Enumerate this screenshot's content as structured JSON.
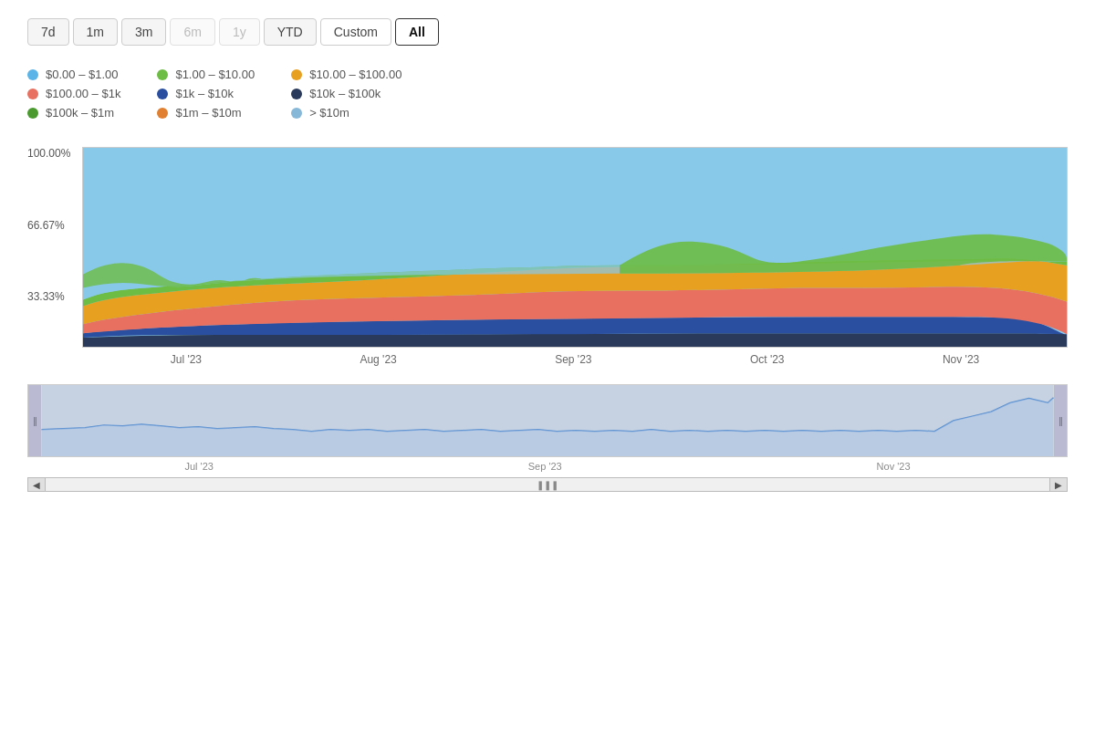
{
  "timeButtons": [
    {
      "label": "7d",
      "state": "normal"
    },
    {
      "label": "1m",
      "state": "normal"
    },
    {
      "label": "3m",
      "state": "normal"
    },
    {
      "label": "6m",
      "state": "disabled"
    },
    {
      "label": "1y",
      "state": "disabled"
    },
    {
      "label": "YTD",
      "state": "normal"
    },
    {
      "label": "Custom",
      "state": "custom"
    },
    {
      "label": "All",
      "state": "active"
    }
  ],
  "legend": [
    {
      "label": "$0.00 – $1.00",
      "color": "#5ab4e8"
    },
    {
      "label": "$1.00 – $10.00",
      "color": "#6dbd45"
    },
    {
      "label": "$10.00 – $100.00",
      "color": "#e8a020"
    },
    {
      "label": "$100.00 – $1k",
      "color": "#e87060"
    },
    {
      "label": "$1k – $10k",
      "color": "#2a4fa0"
    },
    {
      "label": "$10k – $100k",
      "color": "#2a3a5a"
    },
    {
      "label": "$100k – $1m",
      "color": "#4a9a30"
    },
    {
      "label": "$1m – $10m",
      "color": "#e08030"
    },
    {
      "label": "> $10m",
      "color": "#88b8d8"
    }
  ],
  "yLabels": [
    "100.00%",
    "66.67%",
    "33.33%",
    ""
  ],
  "xLabels": [
    "Jul '23",
    "Aug '23",
    "Sep '23",
    "Oct '23",
    "Nov '23"
  ],
  "navXLabels": [
    "Jul '23",
    "Sep '23",
    "Nov '23"
  ],
  "colors": {
    "blue": "#5ab4e8",
    "green": "#6dbd45",
    "orange": "#e8a020",
    "salmon": "#e87060",
    "darkblue": "#2a4fa0",
    "darknavy": "#2a3a5a",
    "darkgreen": "#4a9a30",
    "darkorange": "#e08030",
    "lightblue": "#88b8d8",
    "gray": "#aaaaaa"
  }
}
